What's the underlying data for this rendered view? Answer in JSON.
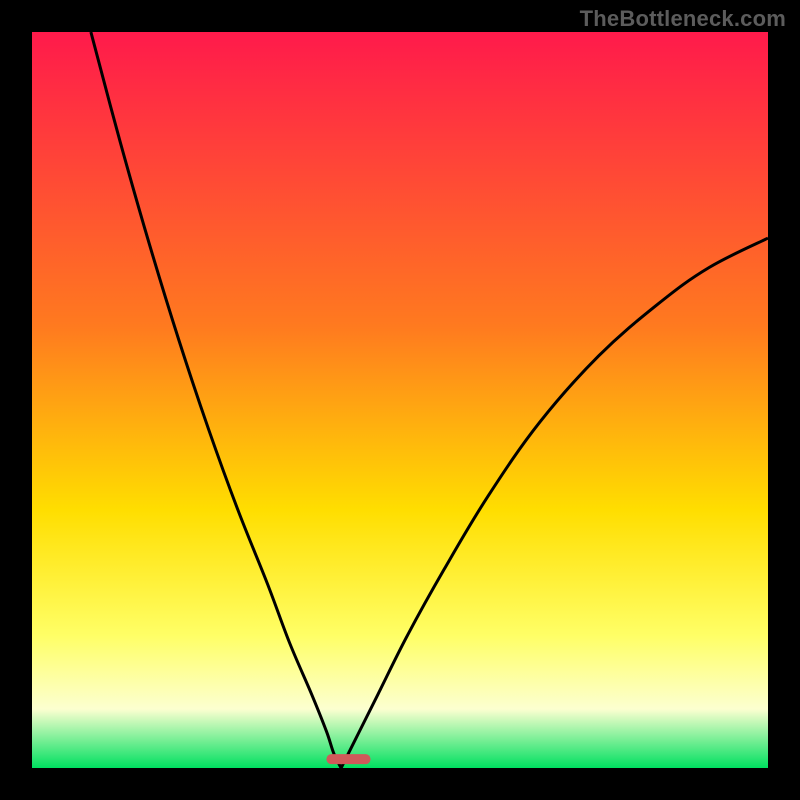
{
  "watermark": "TheBottleneck.com",
  "colors": {
    "bg": "#000000",
    "grad_top": "#ff1a4b",
    "grad_mid1": "#ff7a1f",
    "grad_mid2": "#ffde00",
    "grad_yellow": "#ffff66",
    "grad_pale": "#fcffd0",
    "grad_green": "#00e060",
    "curve": "#000000",
    "marker": "#cf5a5a"
  },
  "chart_data": {
    "type": "line",
    "title": "",
    "xlabel": "",
    "ylabel": "",
    "xlim": [
      0,
      100
    ],
    "ylim": [
      0,
      100
    ],
    "grid": false,
    "legend": false,
    "notes": "Two monotone curves descending to a common minimum near x≈42, y≈0. Left branch starts at (≈8,100); right branch ends at (100,≈72). A short horizontal marker sits at the minimum.",
    "series": [
      {
        "name": "left-branch",
        "x": [
          8,
          12,
          16,
          20,
          24,
          28,
          32,
          35,
          38,
          40,
          41,
          42
        ],
        "y": [
          100,
          85,
          71,
          58,
          46,
          35,
          25,
          17,
          10,
          5,
          2,
          0
        ]
      },
      {
        "name": "right-branch",
        "x": [
          42,
          44,
          47,
          51,
          56,
          62,
          69,
          77,
          85,
          92,
          100
        ],
        "y": [
          0,
          4,
          10,
          18,
          27,
          37,
          47,
          56,
          63,
          68,
          72
        ]
      }
    ],
    "marker": {
      "x_start": 40,
      "x_end": 46,
      "y": 1.2
    }
  }
}
